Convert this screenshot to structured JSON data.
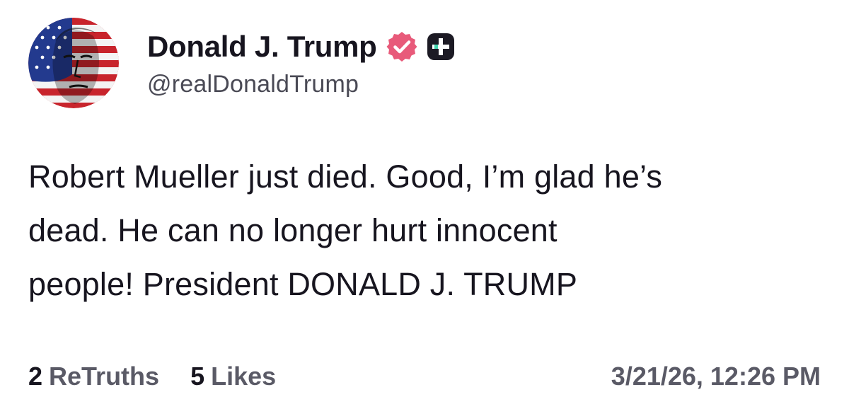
{
  "author": {
    "display_name": "Donald J. Trump",
    "handle": "@realDonaldTrump",
    "verified_color": "#e85a7a",
    "avatar_icon": "flag-portrait-avatar",
    "badges": [
      "verified-check-icon",
      "plus-badge-icon"
    ]
  },
  "post": {
    "lines": [
      "Robert Mueller just died. Good, I’m glad he’s",
      "dead. He can no longer hurt innocent",
      "people! President DONALD J. TRUMP"
    ]
  },
  "stats": {
    "retruths_count": "2",
    "retruths_label": "ReTruths",
    "likes_count": "5",
    "likes_label": "Likes"
  },
  "timestamp": "3/21/26, 12:26 PM",
  "colors": {
    "text_primary": "#17151f",
    "text_secondary": "#5a5a66",
    "badge_dark": "#1c1a24"
  }
}
